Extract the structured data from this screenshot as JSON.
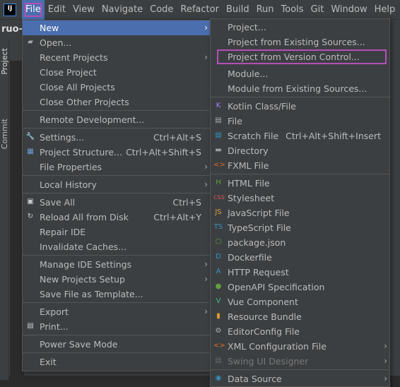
{
  "menubar": {
    "logo": "IJ",
    "items": [
      "File",
      "Edit",
      "View",
      "Navigate",
      "Code",
      "Refactor",
      "Build",
      "Run",
      "Tools",
      "Git",
      "Window",
      "Help"
    ],
    "active": "File"
  },
  "ide": {
    "project_title": "ruo-",
    "tool_tabs": [
      "Project",
      "Commit"
    ]
  },
  "colors": {
    "highlight": "#4b6eaf",
    "focus_box": "#b250b8",
    "background": "#3c3f41"
  },
  "file_menu": [
    {
      "label": "New",
      "submenu": true,
      "highlighted": true
    },
    {
      "label": "Open...",
      "icon": "folder-open-icon"
    },
    {
      "label": "Recent Projects",
      "submenu": true
    },
    {
      "label": "Close Project"
    },
    {
      "label": "Close All Projects"
    },
    {
      "label": "Close Other Projects"
    },
    {
      "separator": true
    },
    {
      "label": "Remote Development..."
    },
    {
      "separator": true
    },
    {
      "label": "Settings...",
      "shortcut": "Ctrl+Alt+S",
      "icon": "wrench-icon"
    },
    {
      "label": "Project Structure...",
      "shortcut": "Ctrl+Alt+Shift+S",
      "icon": "project-structure-icon"
    },
    {
      "label": "File Properties",
      "submenu": true
    },
    {
      "separator": true
    },
    {
      "label": "Local History",
      "submenu": true
    },
    {
      "separator": true
    },
    {
      "label": "Save All",
      "shortcut": "Ctrl+S",
      "icon": "save-icon"
    },
    {
      "label": "Reload All from Disk",
      "shortcut": "Ctrl+Alt+Y",
      "icon": "reload-icon"
    },
    {
      "label": "Repair IDE"
    },
    {
      "label": "Invalidate Caches..."
    },
    {
      "separator": true
    },
    {
      "label": "Manage IDE Settings",
      "submenu": true
    },
    {
      "label": "New Projects Setup",
      "submenu": true
    },
    {
      "label": "Save File as Template..."
    },
    {
      "separator": true
    },
    {
      "label": "Export",
      "submenu": true
    },
    {
      "label": "Print...",
      "icon": "printer-icon"
    },
    {
      "separator": true
    },
    {
      "label": "Power Save Mode"
    },
    {
      "separator": true
    },
    {
      "label": "Exit"
    }
  ],
  "new_submenu": [
    {
      "label": "Project..."
    },
    {
      "label": "Project from Existing Sources..."
    },
    {
      "label": "Project from Version Control...",
      "boxed": true
    },
    {
      "gap": true
    },
    {
      "label": "Module..."
    },
    {
      "label": "Module from Existing Sources..."
    },
    {
      "separator": true
    },
    {
      "label": "Kotlin Class/File",
      "icon": "kotlin-file-icon"
    },
    {
      "label": "File",
      "icon": "file-icon"
    },
    {
      "label": "Scratch File",
      "shortcut": "Ctrl+Alt+Shift+Insert",
      "icon": "scratch-file-icon"
    },
    {
      "label": "Directory",
      "icon": "directory-icon"
    },
    {
      "label": "FXML File",
      "icon": "fxml-file-icon"
    },
    {
      "separator": true
    },
    {
      "label": "HTML File",
      "icon": "html-file-icon"
    },
    {
      "label": "Stylesheet",
      "icon": "css-file-icon"
    },
    {
      "label": "JavaScript File",
      "icon": "js-file-icon"
    },
    {
      "label": "TypeScript File",
      "icon": "ts-file-icon"
    },
    {
      "label": "package.json",
      "icon": "nodejs-icon"
    },
    {
      "label": "Dockerfile",
      "icon": "docker-icon"
    },
    {
      "label": "HTTP Request",
      "icon": "http-request-icon"
    },
    {
      "label": "OpenAPI Specification",
      "icon": "openapi-icon"
    },
    {
      "label": "Vue Component",
      "icon": "vue-icon"
    },
    {
      "label": "Resource Bundle",
      "icon": "resource-bundle-icon"
    },
    {
      "label": "EditorConfig File",
      "icon": "gear-icon"
    },
    {
      "label": "XML Configuration File",
      "icon": "xml-file-icon",
      "submenu": true
    },
    {
      "label": "Swing UI Designer",
      "icon": "swing-icon",
      "submenu": true,
      "disabled": true
    },
    {
      "separator": true
    },
    {
      "label": "Data Source",
      "icon": "database-icon",
      "submenu": true
    }
  ]
}
